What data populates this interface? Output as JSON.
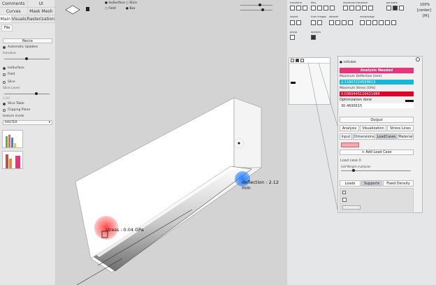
{
  "left_panel": {
    "top_tabs": [
      "Comments",
      "UI"
    ],
    "second_tabs": [
      "Curves",
      "Mask Mesh"
    ],
    "third_tabs": [
      "Main",
      "Visuals",
      "Rasterization"
    ],
    "file_tab": "File",
    "recolor_button": "Recce",
    "automatic_updates": "Automatic Updates",
    "isovalue_label": "Isovalue",
    "isosurface": "IsoSurface",
    "field": "Field",
    "slice": "Slice",
    "slice_level": "Slice Level",
    "slice_value": "0.00",
    "slice_table": "Slice Table",
    "clipping_plane": "Clipping Plane",
    "texture_mode_label": "texture mode",
    "texture_mode_value": "RASTER"
  },
  "viewport": {
    "isosurface": "IsoSurface",
    "field": "Field",
    "slice": "Slice",
    "box": "Box",
    "deflection_label": "deflection : 2.12 mm",
    "stress_label": "stress : 0.04 GPa"
  },
  "right_panel": {
    "top_right": {
      "zoom": "100%",
      "center": "[center]",
      "fit": "[fit]"
    },
    "toolbar_groups": [
      "transform",
      "files",
      "imprecise transform",
      "generate",
      "import",
      "from images",
      "dataset",
      "morphology",
      "group",
      "analysis"
    ],
    "props": {
      "analysis_needed": "Analysis Needed",
      "max_deflection_label": "Maximum Deflection [mm]",
      "max_deflection_value": "2.11807224559613",
      "max_stress_label": "Maximum Stress [GPa]",
      "max_stress_value": "0.0360445110421986",
      "optimization_status": "Optimization done",
      "optimization_value": "30.4695615",
      "output_button": "Output",
      "tabs_row1": [
        "Analysis",
        "Visualization",
        "Stress Lines"
      ],
      "tabs_row2": [
        "Input",
        "Dimensions",
        "LoadCases",
        "Material"
      ],
      "add_load_case": "+ Add Load Case",
      "load_case_title": "Load case 0",
      "self_weight": "Self-Weight multiplier",
      "tabs_row3": [
        "Loads",
        "Supports",
        "Fixed Density"
      ],
      "visible_label": "isVisible"
    },
    "colors": {
      "accent_pink": "#e9347b",
      "deflection_blue": "#17b6d6",
      "stress_red": "#e0002a"
    }
  }
}
